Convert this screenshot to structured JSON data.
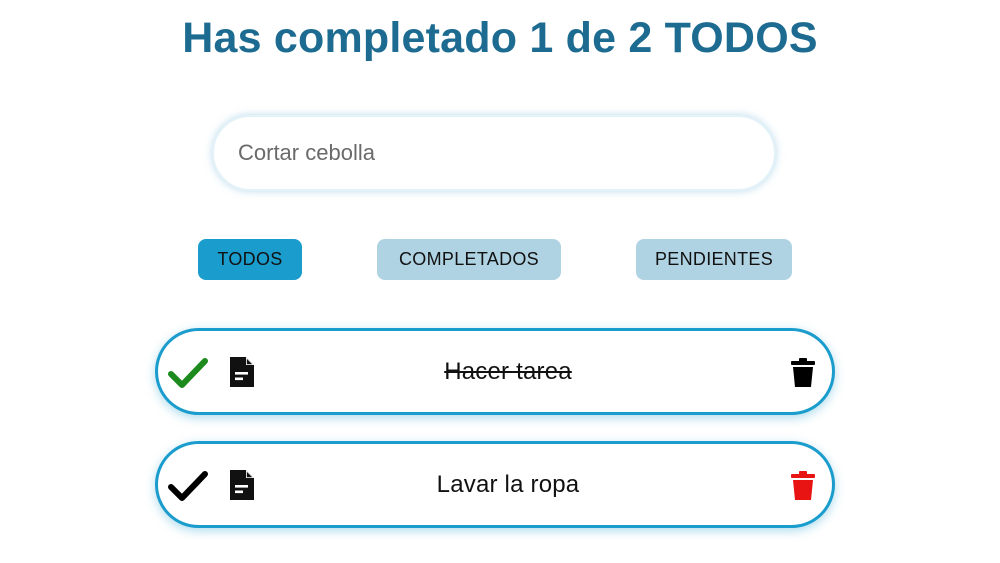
{
  "header": {
    "title": "Has completado 1 de 2 TODOS"
  },
  "search": {
    "placeholder": "Cortar cebolla",
    "value": ""
  },
  "filters": {
    "todos_label": "TODOS",
    "completados_label": "COMPLETADOS",
    "pendientes_label": "PENDIENTES",
    "active": "TODOS"
  },
  "todos": [
    {
      "text": "Hacer tarea",
      "completed": true,
      "check_icon": "check-icon",
      "check_color": "#1c8a1c",
      "doc_icon": "document-icon",
      "trash_icon": "trash-icon",
      "trash_color": "#000000"
    },
    {
      "text": "Lavar la ropa",
      "completed": false,
      "check_icon": "check-icon",
      "check_color": "#000000",
      "doc_icon": "document-icon",
      "trash_icon": "trash-icon",
      "trash_color": "#e81313"
    }
  ],
  "colors": {
    "title": "#1d6b91",
    "accent": "#1a9ccc",
    "filter_inactive": "#b0d3e3"
  }
}
